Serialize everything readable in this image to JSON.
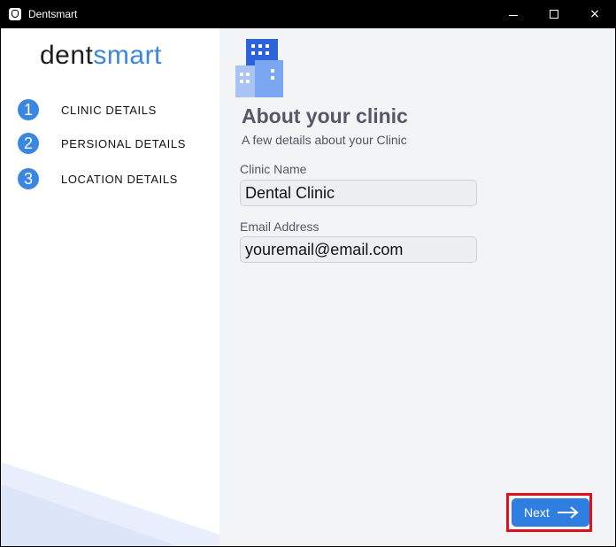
{
  "window": {
    "title": "Dentsmart",
    "app_icon": "tooth-icon",
    "controls": {
      "minimize": "minimize-icon",
      "maximize": "maximize-icon",
      "close": "×"
    }
  },
  "sidebar": {
    "logo": {
      "dent": "dent",
      "smart": "smart"
    },
    "steps": [
      {
        "number": "1",
        "label": "CLINIC DETAILS"
      },
      {
        "number": "2",
        "label": "PERSIONAL DETAILS"
      },
      {
        "number": "3",
        "label": "LOCATION DETAILS"
      }
    ]
  },
  "main": {
    "icon": "building-icon",
    "title": "About your clinic",
    "subtitle": "A few details about your Clinic",
    "clinic_name": {
      "label": "Clinic Name",
      "value": "Dental Clinic"
    },
    "email": {
      "label": "Email Address",
      "value": "youremail@email.com"
    },
    "next_label": "Next",
    "next_icon": "arrow-right-icon"
  },
  "colors": {
    "accent": "#3b86e0",
    "button": "#2f7ee0",
    "highlight": "#e0101f",
    "main_bg": "#f3f4f6",
    "heading": "#545867"
  }
}
